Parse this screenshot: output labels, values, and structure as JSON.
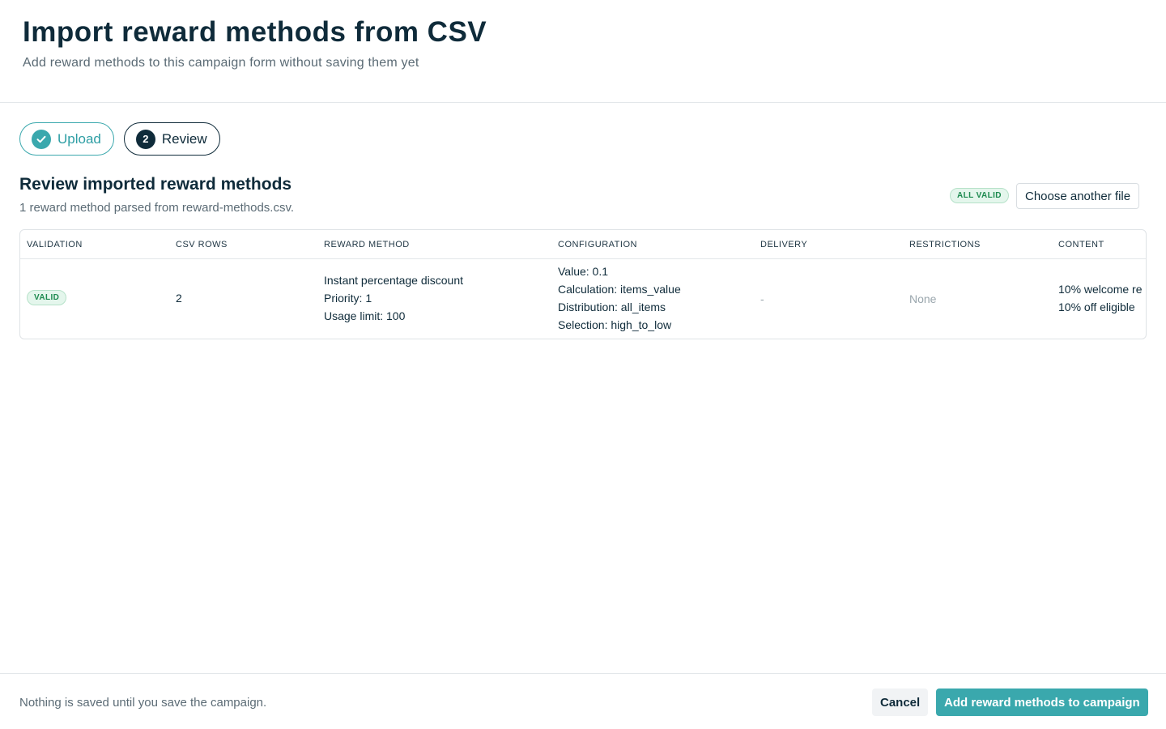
{
  "header": {
    "title": "Import reward methods from CSV",
    "subtitle": "Add reward methods to this campaign form without saving them yet"
  },
  "steps": [
    {
      "label": "Upload",
      "state": "complete",
      "icon": "check-icon"
    },
    {
      "label": "Review",
      "state": "current",
      "number": "2"
    }
  ],
  "review": {
    "title": "Review imported reward methods",
    "summary": "1 reward method parsed from reward-methods.csv.",
    "status_badge": "ALL VALID",
    "choose_file_label": "Choose another file"
  },
  "table": {
    "columns": [
      "VALIDATION",
      "CSV ROWS",
      "REWARD METHOD",
      "CONFIGURATION",
      "DELIVERY",
      "RESTRICTIONS",
      "CONTENT"
    ],
    "rows": [
      {
        "validation": "VALID",
        "csv_rows": "2",
        "reward_method": [
          "Instant percentage discount",
          "Priority: 1",
          "Usage limit: 100"
        ],
        "configuration": [
          "Value: 0.1",
          "Calculation: items_value",
          "Distribution: all_items",
          "Selection: high_to_low"
        ],
        "delivery": "-",
        "restrictions": "None",
        "content": [
          "10% welcome re",
          "10% off eligible"
        ]
      }
    ]
  },
  "footer": {
    "note": "Nothing is saved until you save the campaign.",
    "cancel_label": "Cancel",
    "submit_label": "Add reward methods to campaign"
  },
  "colors": {
    "accent": "#3aa8ad",
    "text_dark": "#0f2b3a",
    "valid_badge_bg": "#e4f6ec",
    "valid_badge_text": "#1d8a4f"
  }
}
